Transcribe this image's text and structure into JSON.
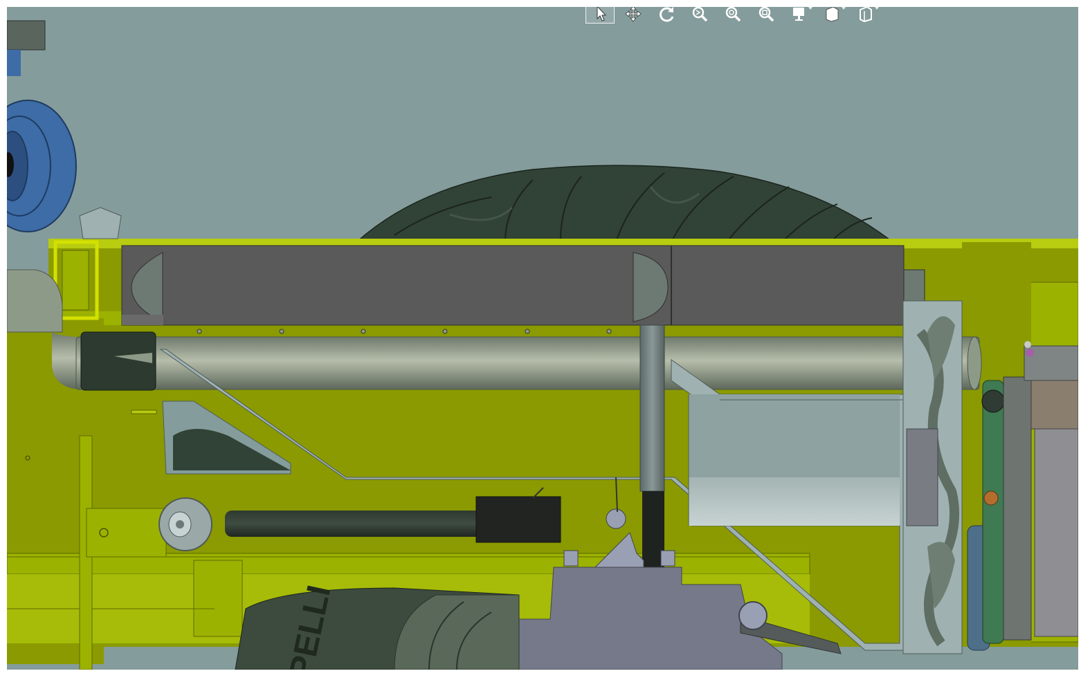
{
  "viewer": {
    "background_color": "#849c9b",
    "frame_color": "#9cb200",
    "tire_color": "#314236",
    "panel_color": "#5a5a5a",
    "tube_color": "#8e9a88",
    "housing_color": "#767989"
  },
  "toolbar": {
    "tools": [
      {
        "icon": "select-icon",
        "active": true
      },
      {
        "icon": "pan-icon",
        "active": false
      },
      {
        "icon": "rotate-icon",
        "active": false
      },
      {
        "icon": "zoom-icon",
        "active": false
      },
      {
        "icon": "zoom-in-out-icon",
        "active": false
      },
      {
        "icon": "zoom-fit-icon",
        "active": false
      },
      {
        "icon": "view-orientation-icon",
        "active": false,
        "has_menu": true
      },
      {
        "icon": "display-style-icon",
        "active": false,
        "has_menu": true
      },
      {
        "icon": "section-view-icon",
        "active": false,
        "has_menu": true
      }
    ]
  },
  "viewport": {
    "tire_text": "PELLI"
  }
}
